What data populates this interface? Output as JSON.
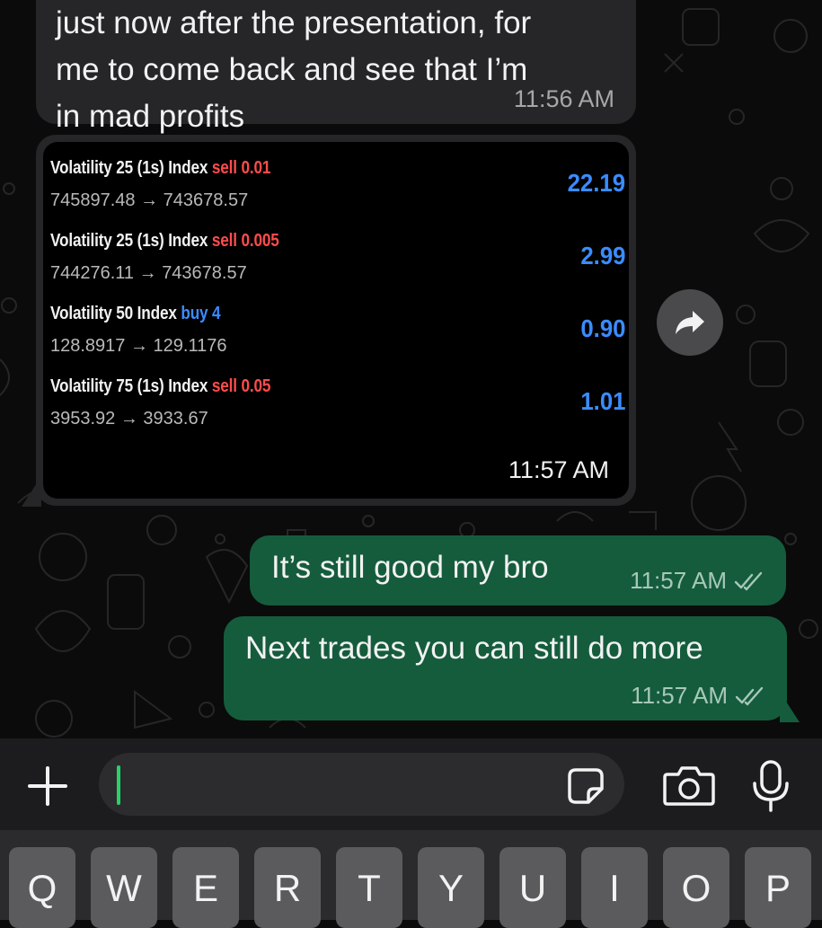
{
  "messages": [
    {
      "type": "incoming",
      "text_lines": [
        "just now after the presentation, for",
        "me to come back and see that I’m",
        "in mad profits"
      ],
      "time": "11:56 AM"
    },
    {
      "type": "incoming-image",
      "time": "11:57 AM",
      "trades": [
        {
          "instrument": "Volatility 25 (1s) Index",
          "action": "sell",
          "amount": "0.01",
          "from": "745897.48",
          "to": "743678.57",
          "profit": "22.19"
        },
        {
          "instrument": "Volatility 25 (1s) Index",
          "action": "sell",
          "amount": "0.005",
          "from": "744276.11",
          "to": "743678.57",
          "profit": "2.99"
        },
        {
          "instrument": "Volatility 50 Index",
          "action": "buy",
          "amount": "4",
          "from": "128.8917",
          "to": "129.1176",
          "profit": "0.90"
        },
        {
          "instrument": "Volatility 75 (1s) Index",
          "action": "sell",
          "amount": "0.05",
          "from": "3953.92",
          "to": "3933.67",
          "profit": "1.01"
        }
      ]
    },
    {
      "type": "outgoing",
      "text": "It’s still good my bro",
      "time": "11:57 AM",
      "status": "read"
    },
    {
      "type": "outgoing",
      "text": "Next trades you can still do more",
      "time": "11:57 AM",
      "status": "read"
    }
  ],
  "arrow_glyph": "→",
  "input": {
    "value": "",
    "placeholder": ""
  },
  "icons": {
    "forward": "forward-icon",
    "plus": "plus-icon",
    "sticker": "sticker-icon",
    "camera": "camera-icon",
    "mic": "mic-icon",
    "read_receipt": "double-check-icon"
  },
  "keyboard": {
    "row1": [
      "Q",
      "W",
      "E",
      "R",
      "T",
      "Y",
      "U",
      "I",
      "O",
      "P"
    ]
  },
  "colors": {
    "outgoing_bubble": "#155c3d",
    "incoming_bubble": "#262628",
    "sell": "#ff4b4b",
    "buy": "#3b8cff",
    "profit": "#3b8cff",
    "caret": "#25d366"
  }
}
